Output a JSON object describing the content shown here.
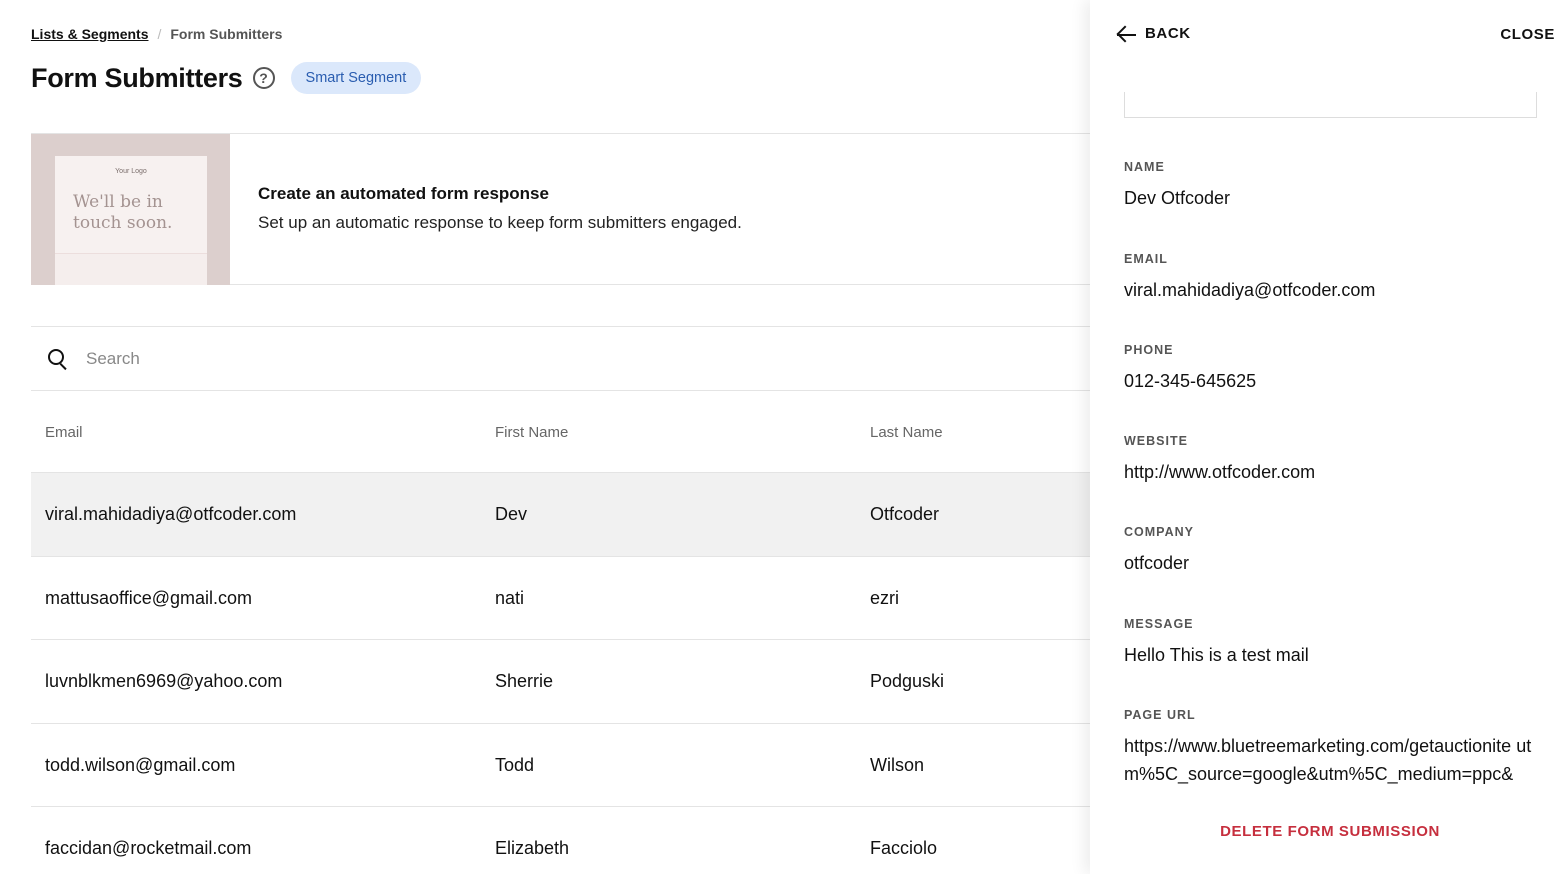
{
  "breadcrumb": {
    "parent": "Lists & Segments",
    "separator": "/",
    "current": "Form Submitters"
  },
  "page": {
    "title": "Form Submitters",
    "badge": "Smart Segment"
  },
  "promo": {
    "thumb_logo": "Your Logo",
    "thumb_headline": "We'll be in touch soon.",
    "heading": "Create an automated form response",
    "subtext": "Set up an automatic response to keep form submitters engaged."
  },
  "search": {
    "placeholder": "Search"
  },
  "table": {
    "columns": [
      "Email",
      "First Name",
      "Last Name"
    ],
    "rows": [
      {
        "email": "viral.mahidadiya@otfcoder.com",
        "first": "Dev",
        "last": "Otfcoder"
      },
      {
        "email": "mattusaoffice@gmail.com",
        "first": "nati",
        "last": "ezri"
      },
      {
        "email": "luvnblkmen6969@yahoo.com",
        "first": "Sherrie",
        "last": "Podguski"
      },
      {
        "email": "todd.wilson@gmail.com",
        "first": "Todd",
        "last": "Wilson"
      },
      {
        "email": "faccidan@rocketmail.com",
        "first": "Elizabeth",
        "last": "Facciolo"
      }
    ]
  },
  "panel": {
    "back_label": "BACK",
    "close_label": "CLOSE",
    "fields": {
      "name": {
        "label": "NAME",
        "value": "Dev Otfcoder"
      },
      "email": {
        "label": "EMAIL",
        "value": "viral.mahidadiya@otfcoder.com"
      },
      "phone": {
        "label": "PHONE",
        "value": "012-345-645625"
      },
      "website": {
        "label": "WEBSITE",
        "value": "http://www.otfcoder.com"
      },
      "company": {
        "label": "COMPANY",
        "value": "otfcoder"
      },
      "message": {
        "label": "MESSAGE",
        "value": "Hello This is a test mail"
      },
      "page_url": {
        "label": "PAGE URL",
        "value": "https://www.bluetreemarketing.com/getauctionite utm%5C_source=google&utm%5C_medium=ppc&"
      }
    },
    "delete_label": "DELETE FORM SUBMISSION"
  }
}
